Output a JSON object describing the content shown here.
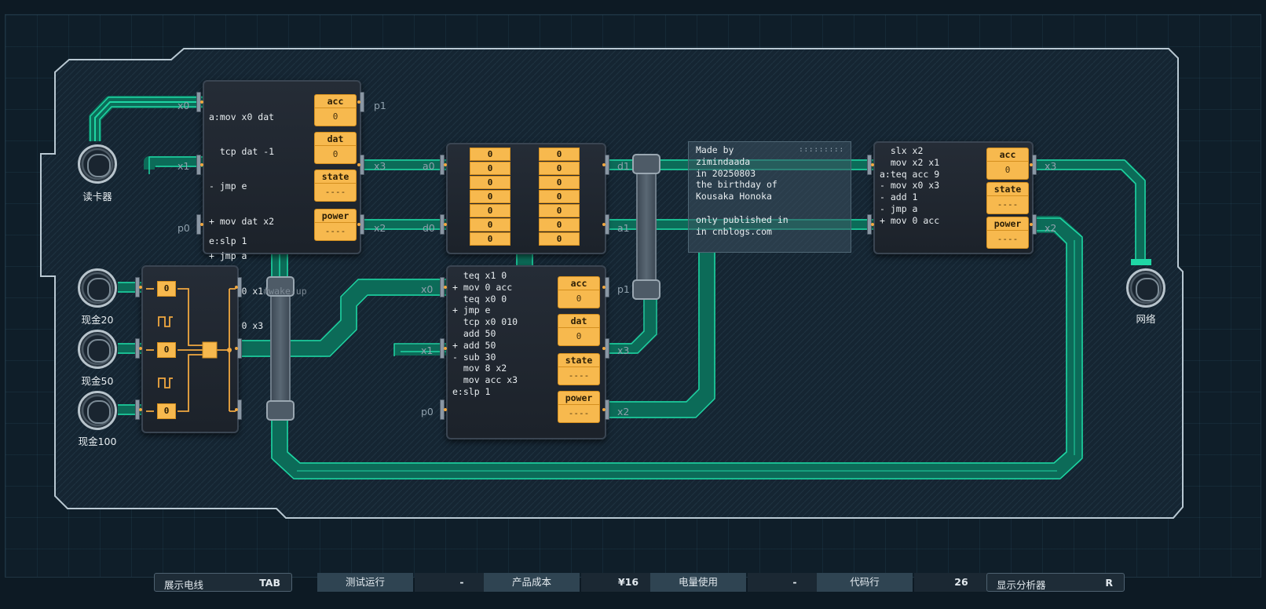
{
  "chip_a": {
    "code_lines": [
      {
        "t": "a:mov x0 dat",
        "c": ""
      },
      {
        "t": "  tcp dat -1",
        "c": ""
      },
      {
        "t": "- jmp e",
        "c": ""
      },
      {
        "t": "+ mov dat x2",
        "c": ""
      },
      {
        "t": "+ jmp a",
        "c": ""
      },
      {
        "t": "  mov 0 x1",
        "c": "#wake-up"
      },
      {
        "t": "  mov 0 x3",
        "c": ""
      }
    ],
    "code_tail": "e:slp 1",
    "regs": [
      {
        "label": "acc",
        "value": "0"
      },
      {
        "label": "dat",
        "value": "0"
      },
      {
        "label": "state",
        "value": "----"
      },
      {
        "label": "power",
        "value": "----"
      }
    ],
    "pins": {
      "left": [
        "x0",
        "x1",
        "p0"
      ],
      "right": [
        "p1",
        "x3",
        "x2"
      ]
    }
  },
  "ram": {
    "left_col": [
      "0",
      "0",
      "0",
      "0",
      "0",
      "0",
      "0"
    ],
    "right_col": [
      "0",
      "0",
      "0",
      "0",
      "0",
      "0",
      "0"
    ],
    "pins": {
      "left": [
        "a0",
        "d0"
      ],
      "right": [
        "d1",
        "a1"
      ]
    }
  },
  "chip_b": {
    "code": "  teq x1 0\n+ mov 0 acc\n  teq x0 0\n+ jmp e\n  tcp x0 010\n  add 50\n+ add 50\n- sub 30\n  mov 8 x2\n  mov acc x3\ne:slp 1",
    "regs": [
      {
        "label": "acc",
        "value": "0"
      },
      {
        "label": "dat",
        "value": "0"
      },
      {
        "label": "state",
        "value": "----"
      },
      {
        "label": "power",
        "value": "----"
      }
    ],
    "pins": {
      "left": [
        "x0",
        "x1",
        "p0"
      ],
      "right": [
        "p1",
        "x3",
        "x2"
      ]
    }
  },
  "chip_c": {
    "code": "  slx x2\n  mov x2 x1\na:teq acc 9\n- mov x0 x3\n- add 1\n- jmp a\n+ mov 0 acc",
    "regs": [
      {
        "label": "acc",
        "value": "0"
      },
      {
        "label": "state",
        "value": "----"
      },
      {
        "label": "power",
        "value": "----"
      }
    ],
    "pins": {
      "right": [
        "x3",
        "x2"
      ]
    }
  },
  "note": {
    "text": "Made by\nzimindaada\nin 20250803\nthe birthday of\nKousaka Honoka\n\nonly published in\nin cnblogs.com",
    "grip": ":::::::::"
  },
  "gate_values": [
    "0",
    "0",
    "0"
  ],
  "devices": {
    "card_reader": "读卡器",
    "cash20": "现金20",
    "cash50": "现金50",
    "cash100": "现金100",
    "network": "网络"
  },
  "bottom": {
    "show_wires": {
      "label": "展示电线",
      "key": "TAB"
    },
    "test_run": {
      "label": "测试运行",
      "value": "-"
    },
    "cost": {
      "label": "产品成本",
      "value": "¥16"
    },
    "power": {
      "label": "电量使用",
      "value": "-"
    },
    "lines": {
      "label": "代码行",
      "value": "26"
    },
    "analyzer": {
      "label": "显示分析器",
      "key": "R"
    }
  },
  "colors": {
    "wire": "#1fd6a4",
    "wire_dark": "#0c6b58",
    "register": "#f7b94e",
    "chip_border": "#3a4552"
  }
}
